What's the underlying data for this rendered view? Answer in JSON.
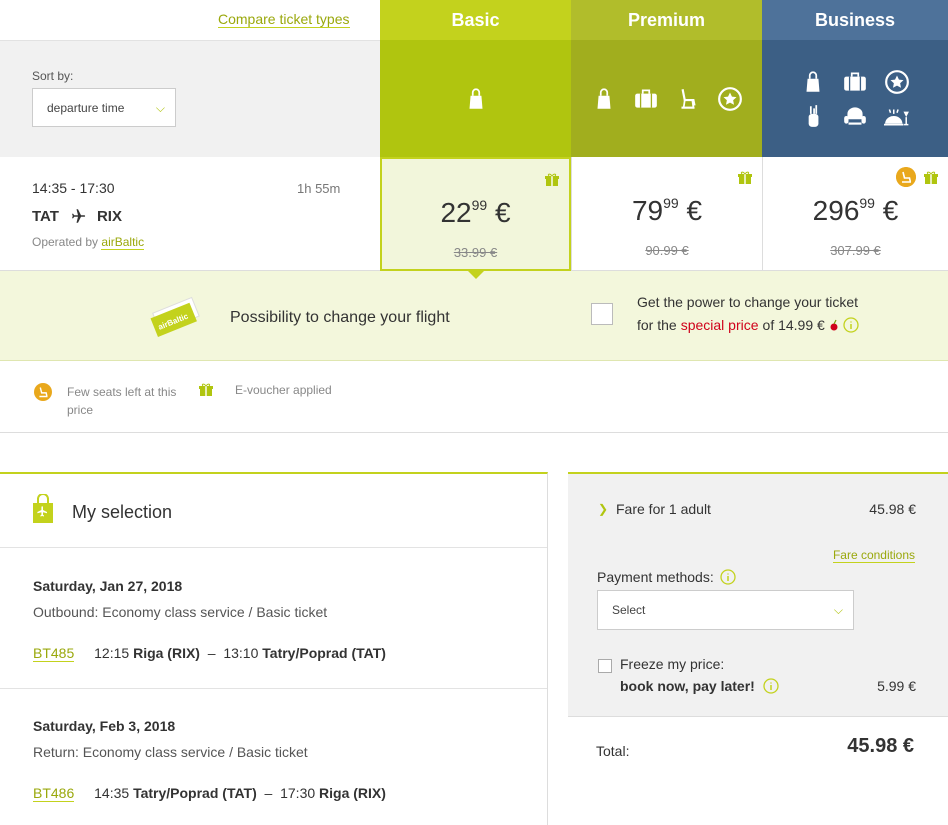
{
  "compare_link": "Compare ticket types",
  "sort": {
    "label": "Sort by:",
    "value": "departure time"
  },
  "fare_types": [
    {
      "name": "Basic",
      "icons": [
        "bag-icon"
      ]
    },
    {
      "name": "Premium",
      "icons": [
        "bag-icon",
        "suitcase-icon",
        "seat-icon",
        "star-icon"
      ]
    },
    {
      "name": "Business",
      "icons": [
        "bag-icon",
        "suitcase-icon",
        "star-icon",
        "golf-bag-icon",
        "lounge-chair-icon",
        "meal-icon"
      ]
    }
  ],
  "flight": {
    "time": "14:35 - 17:30",
    "duration": "1h 55m",
    "from": "TAT",
    "to": "RIX",
    "operated_by": "Operated by",
    "carrier": "airBaltic"
  },
  "prices": [
    {
      "fare": "Basic",
      "int": "22",
      "dec": "99",
      "currency": "€",
      "old": "33.99 €"
    },
    {
      "fare": "Premium",
      "int": "79",
      "dec": "99",
      "currency": "€",
      "old": "90.99 €"
    },
    {
      "fare": "Business",
      "int": "296",
      "dec": "99",
      "currency": "€",
      "old": "307.99 €"
    }
  ],
  "change": {
    "title": "Possibility to change your flight",
    "line1": "Get the power to change your ticket",
    "line2_pre": "for the",
    "line2_special": "special price",
    "line2_post": "of 14.99 €",
    "ticket_brand": "airBaltic"
  },
  "legend": {
    "seats": "Few seats left at this price",
    "voucher": "E-voucher applied"
  },
  "selection": {
    "title": "My selection",
    "segments": [
      {
        "date": "Saturday, Jan 27, 2018",
        "class": "Outbound: Economy class service / Basic ticket",
        "flight_no": "BT485",
        "dep_time": "12:15",
        "dep_place": "Riga (RIX)",
        "arr_time": "13:10",
        "arr_place": "Tatry/Poprad (TAT)"
      },
      {
        "date": "Saturday, Feb 3, 2018",
        "class": "Return: Economy class service / Basic ticket",
        "flight_no": "BT486",
        "dep_time": "14:35",
        "dep_place": "Tatry/Poprad (TAT)",
        "arr_time": "17:30",
        "arr_place": "Riga (RIX)"
      }
    ]
  },
  "fare_panel": {
    "fare_label": "Fare for 1 adult",
    "fare_value": "45.98 €",
    "conditions": "Fare conditions",
    "payment_label": "Payment methods:",
    "payment_placeholder": "Select",
    "freeze_line1": "Freeze my price:",
    "freeze_line2": "book now, pay later!",
    "freeze_price": "5.99 €",
    "total_label": "Total:",
    "total_value": "45.98 €"
  },
  "colors": {
    "accent": "#c3d21d",
    "premium": "#a1ae1e",
    "business": "#3c5f85",
    "special": "#d0021b",
    "seats_badge": "#e9a81c"
  }
}
